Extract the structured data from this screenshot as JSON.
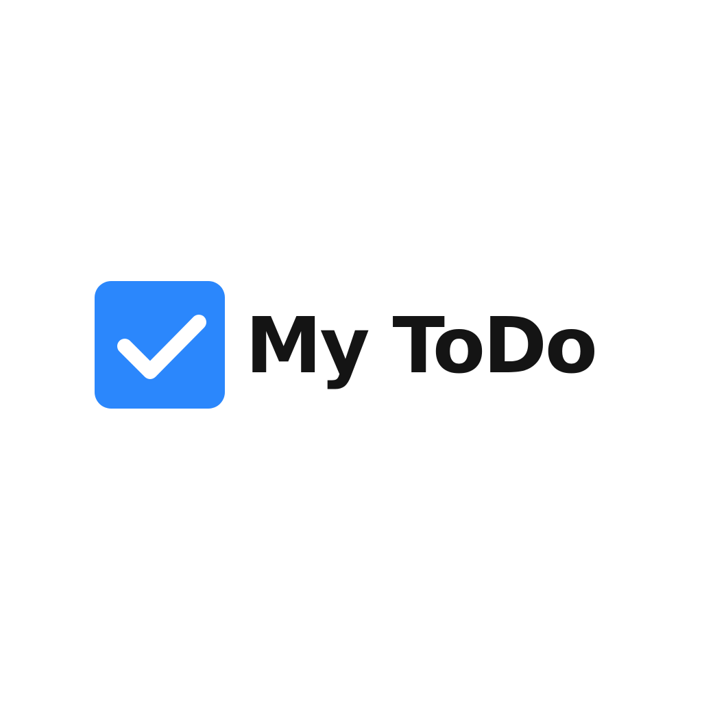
{
  "brand": {
    "name": "My ToDo",
    "icon": "checkmark-icon",
    "accent_color": "#2B87FC",
    "check_color": "#FFFFFF",
    "text_color": "#141414"
  }
}
